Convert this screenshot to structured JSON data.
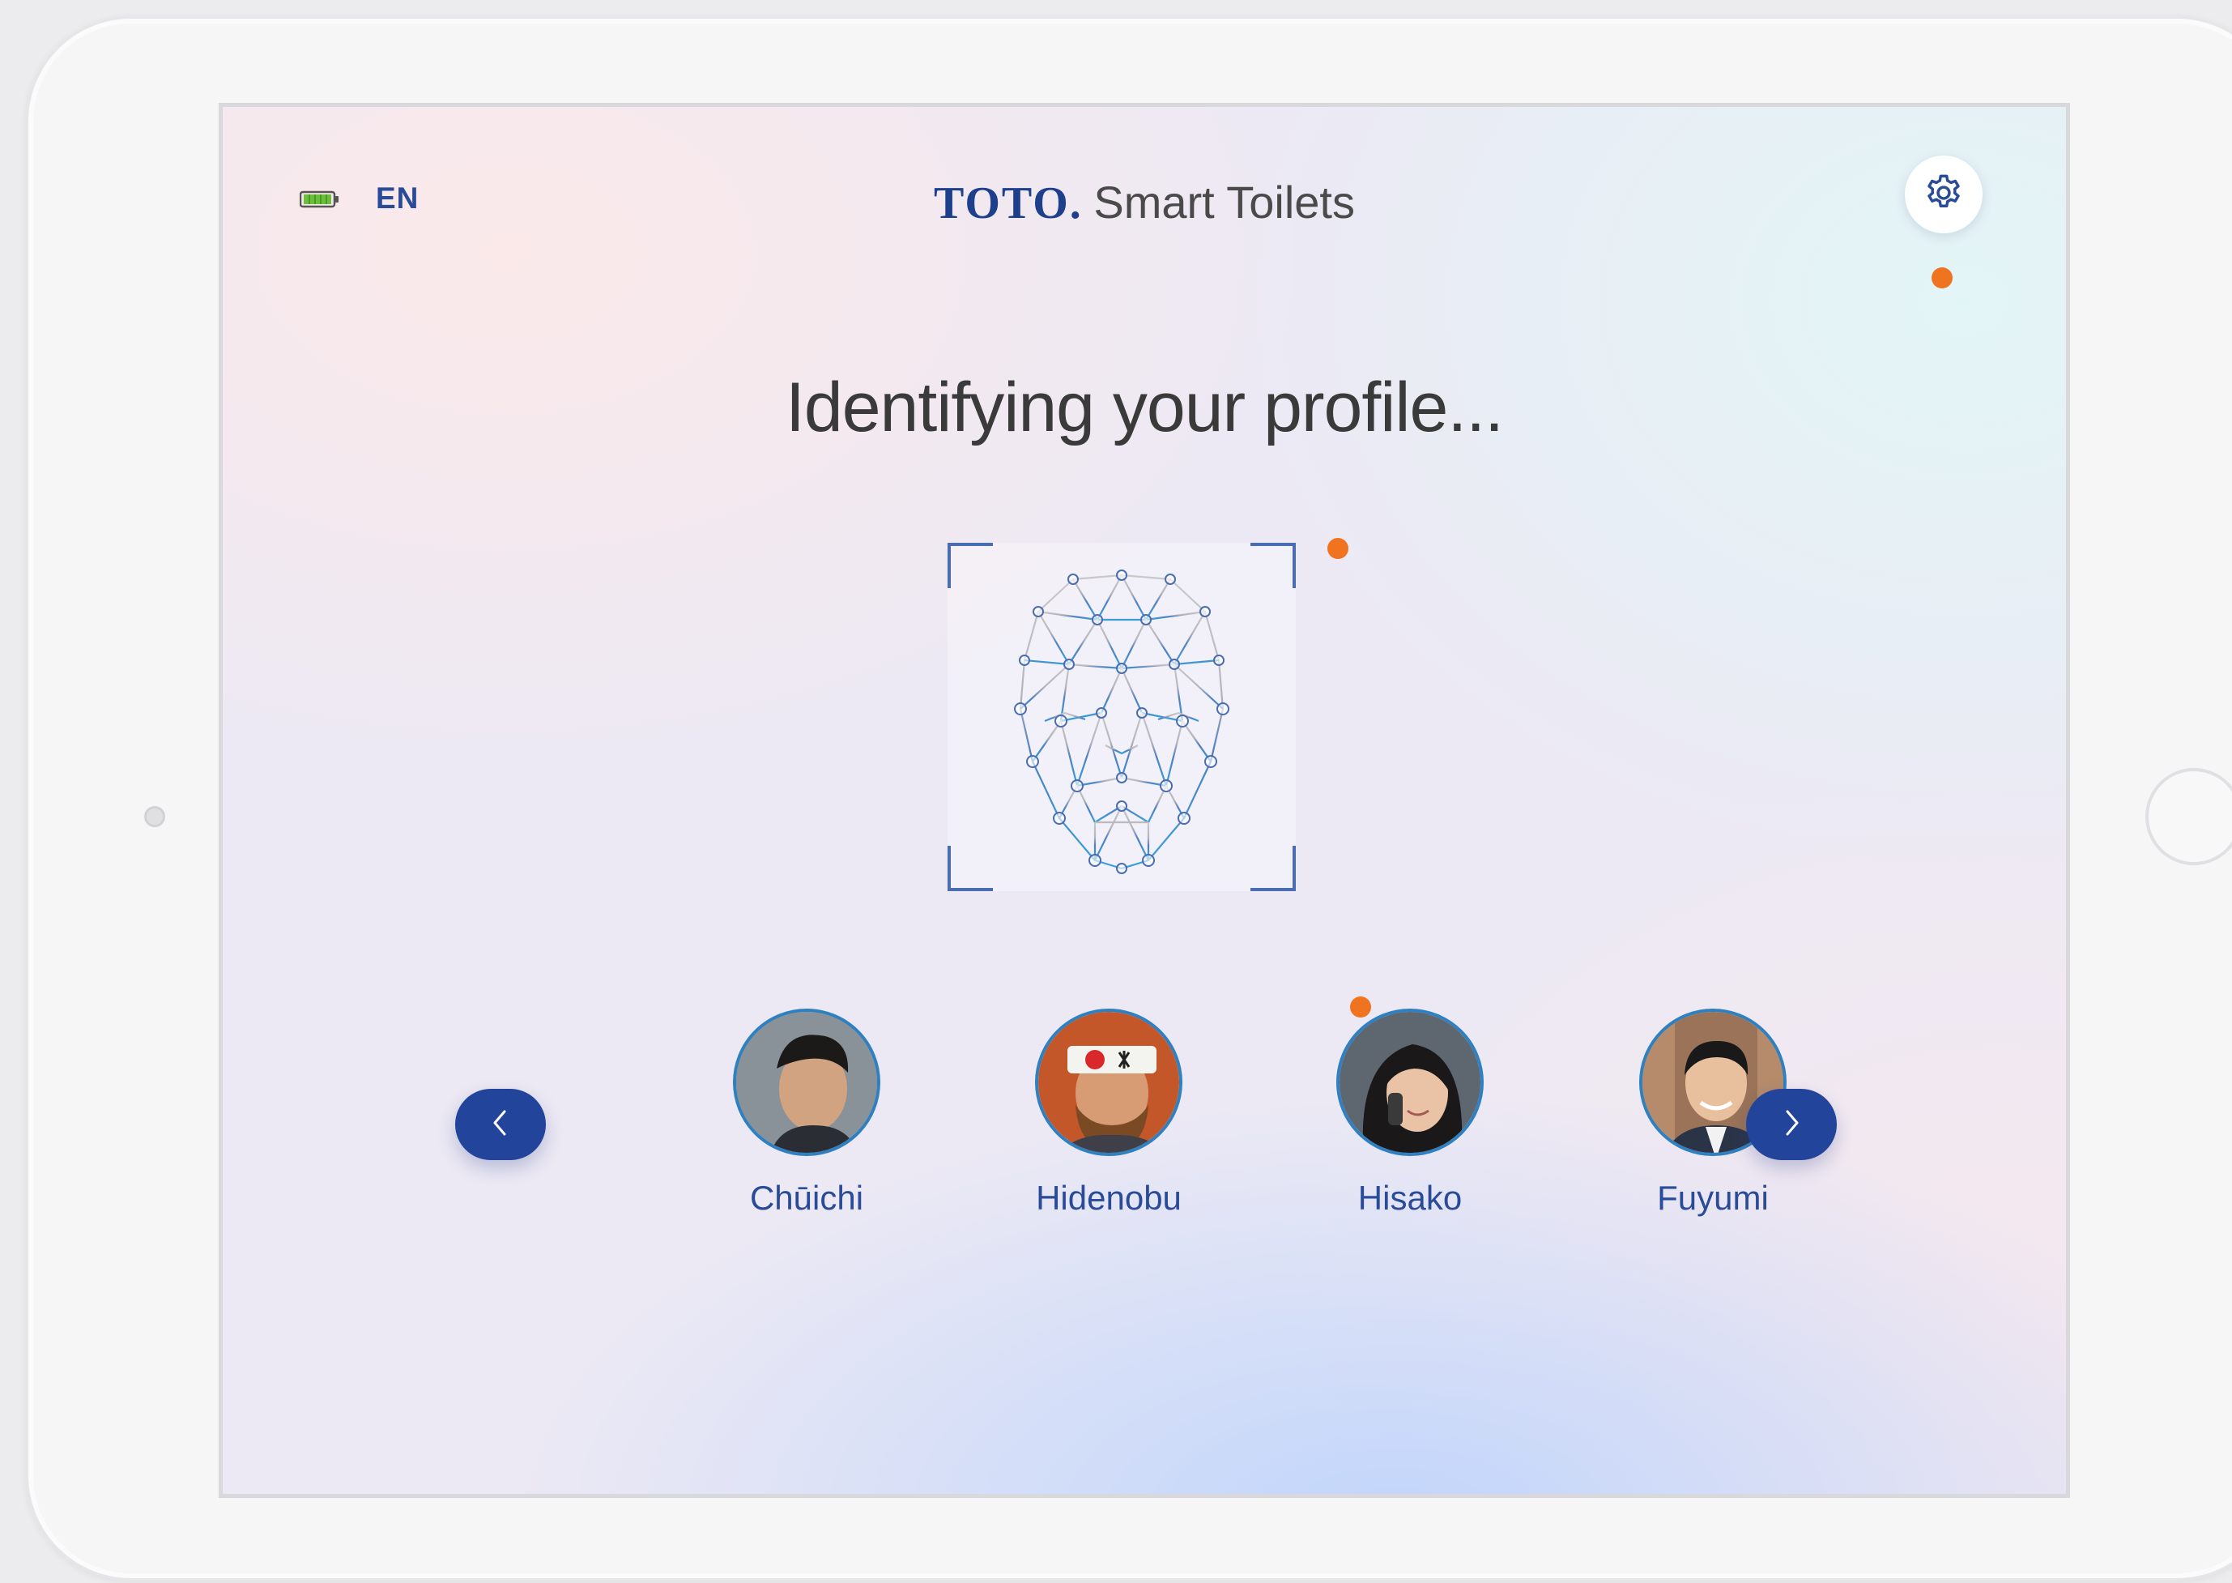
{
  "status": {
    "battery_icon": "battery-full-icon",
    "language": "EN"
  },
  "header": {
    "brand_mark": "TOTO",
    "brand_dot": ".",
    "brand_name": "Smart Toilets",
    "settings_icon": "gear-icon"
  },
  "main": {
    "heading": "Identifying your profile...",
    "face_icon": "face-recognition-icon"
  },
  "profiles": {
    "prev_icon": "chevron-left-icon",
    "next_icon": "chevron-right-icon",
    "items": [
      {
        "name": "Chūichi"
      },
      {
        "name": "Hidenobu"
      },
      {
        "name": "Hisako"
      },
      {
        "name": "Fuyumi"
      }
    ]
  },
  "colors": {
    "accent": "#22459b",
    "text_blue": "#2a4b98",
    "marker": "#f0731f",
    "avatar_ring": "#2f80c0"
  }
}
